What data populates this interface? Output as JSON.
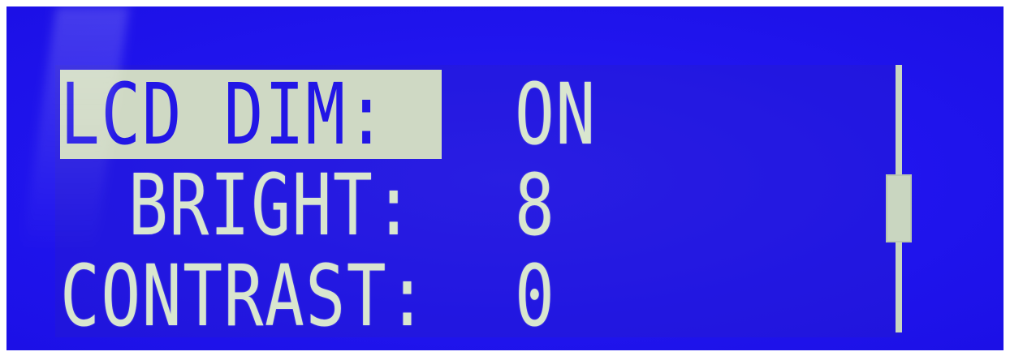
{
  "display": {
    "accent_color": "#2015ee",
    "text_color": "#d9e6cf",
    "highlight_color": "#cfd9c4"
  },
  "menu": {
    "items": [
      {
        "label": "LCD DIM:",
        "value": "ON",
        "selected": true
      },
      {
        "label": "BRIGHT:",
        "value": "8",
        "selected": false
      },
      {
        "label": "CONTRAST:",
        "value": "0",
        "selected": false
      }
    ]
  },
  "scrollbar": {
    "position_fraction": 0.55
  }
}
